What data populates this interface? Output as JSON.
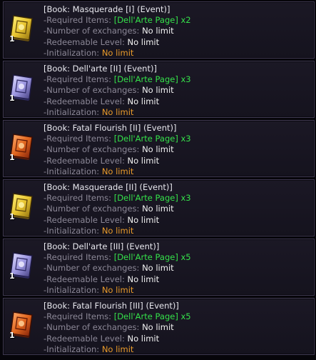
{
  "labels": {
    "required": "-Required Items:",
    "exchanges": "-Number of exchanges:",
    "redeemable": "-Redeemable Level:",
    "initialization": "-Initialization:"
  },
  "colors": {
    "masquerade_book": "#e8c531",
    "dellarte_book": "#9c96e0",
    "fatal_flourish_book": "#e0651e",
    "required_value": "#35e04a",
    "limit_value": "#f2f2f2",
    "init_value": "#e89a2a"
  },
  "items": [
    {
      "title": "[Book: Masquerade [I] (Event)]",
      "icon": "masquerade-book-icon",
      "quantity": "1",
      "required": "[Dell'Arte Page] x2",
      "exchanges": "No limit",
      "redeemable": "No limit",
      "initialization": "No limit"
    },
    {
      "title": "[Book: Dell'arte [II] (Event)]",
      "icon": "dellarte-book-icon",
      "quantity": "1",
      "required": "[Dell'Arte Page] x3",
      "exchanges": "No limit",
      "redeemable": "No limit",
      "initialization": "No limit"
    },
    {
      "title": "[Book: Fatal Flourish [II] (Event)]",
      "icon": "fatal-flourish-book-icon",
      "quantity": "1",
      "required": "[Dell'Arte Page] x3",
      "exchanges": "No limit",
      "redeemable": "No limit",
      "initialization": "No limit"
    },
    {
      "title": "[Book: Masquerade [II] (Event)]",
      "icon": "masquerade-book-icon",
      "quantity": "1",
      "required": "[Dell'Arte Page] x3",
      "exchanges": "No limit",
      "redeemable": "No limit",
      "initialization": "No limit"
    },
    {
      "title": "[Book: Dell'arte [III] (Event)]",
      "icon": "dellarte-book-icon",
      "quantity": "1",
      "required": "[Dell'Arte Page] x5",
      "exchanges": "No limit",
      "redeemable": "No limit",
      "initialization": "No limit"
    },
    {
      "title": "[Book: Fatal Flourish [III] (Event)]",
      "icon": "fatal-flourish-book-icon",
      "quantity": "1",
      "required": "[Dell'Arte Page] x5",
      "exchanges": "No limit",
      "redeemable": "No limit",
      "initialization": "No limit"
    }
  ]
}
